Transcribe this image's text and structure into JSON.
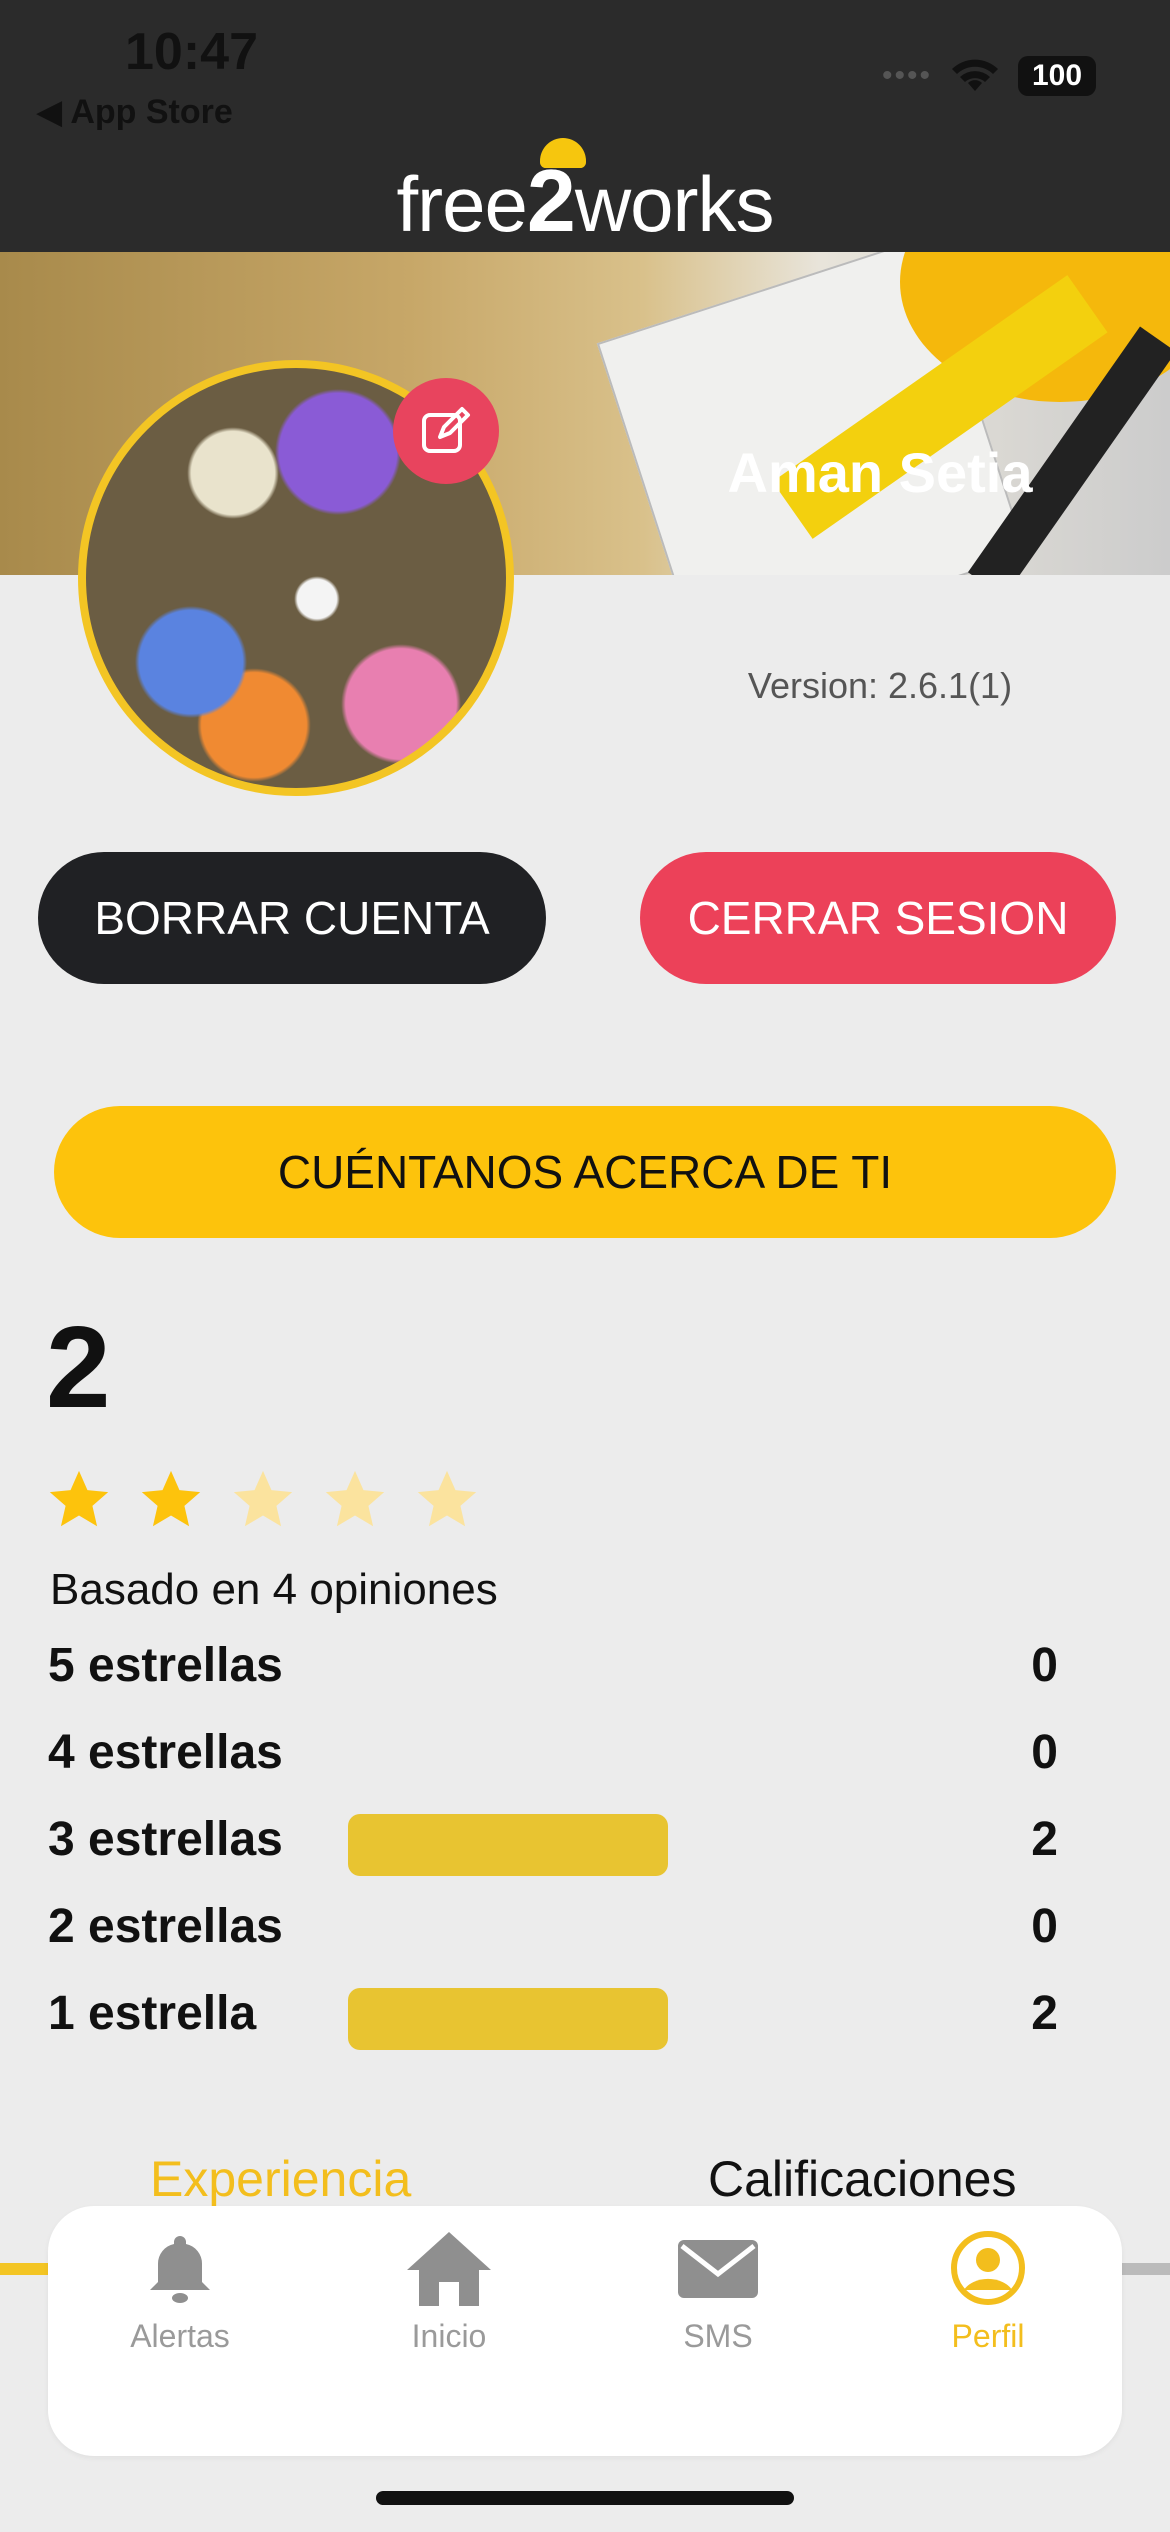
{
  "status_bar": {
    "time": "10:47",
    "back_label": "◀ App Store",
    "battery": "100"
  },
  "header": {
    "logo_pre": "free",
    "logo_num": "2",
    "logo_post": "works"
  },
  "profile": {
    "name": "Aman Setia",
    "version": "Version: 2.6.1(1)"
  },
  "buttons": {
    "delete_account": "BORRAR CUENTA",
    "logout": "CERRAR SESION",
    "about": "CUÉNTANOS ACERCA DE TI"
  },
  "rating": {
    "score": "2",
    "stars_filled": 2,
    "stars_total": 5,
    "based_on": "Basado en 4 opiniones",
    "breakdown": [
      {
        "label": "5 estrellas",
        "count": "0",
        "fraction": 0
      },
      {
        "label": "4 estrellas",
        "count": "0",
        "fraction": 0
      },
      {
        "label": "3 estrellas",
        "count": "2",
        "fraction": 1
      },
      {
        "label": "2 estrellas",
        "count": "0",
        "fraction": 0
      },
      {
        "label": "1 estrella",
        "count": "2",
        "fraction": 1
      }
    ]
  },
  "tabs": {
    "experiencia": "Experiencia",
    "calificaciones": "Calificaciones"
  },
  "nav": [
    {
      "label": "Alertas",
      "icon": "bell-icon"
    },
    {
      "label": "Inicio",
      "icon": "home-icon"
    },
    {
      "label": "SMS",
      "icon": "mail-icon"
    },
    {
      "label": "Perfil",
      "icon": "profile-icon"
    }
  ],
  "colors": {
    "accent_yellow": "#fdc30c",
    "accent_red": "#ec4159",
    "dark": "#202124"
  }
}
